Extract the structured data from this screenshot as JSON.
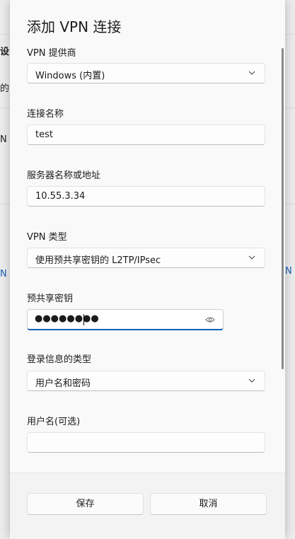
{
  "background": {
    "fragments": [
      {
        "text": "设",
        "bold": true
      },
      {
        "text": "的"
      },
      {
        "text": "N 连"
      },
      {
        "text": "N 连"
      },
      {
        "text": "N"
      }
    ]
  },
  "dialog": {
    "title": "添加 VPN 连接",
    "vpn_provider": {
      "label": "VPN 提供商",
      "value": "Windows (内置)"
    },
    "connection_name": {
      "label": "连接名称",
      "value": "test"
    },
    "server": {
      "label": "服务器名称或地址",
      "value": "10.55.3.34"
    },
    "vpn_type": {
      "label": "VPN 类型",
      "value": "使用预共享密钥的 L2TP/IPsec"
    },
    "psk": {
      "label": "预共享密钥",
      "value": "●●●●●●●●"
    },
    "signin_type": {
      "label": "登录信息的类型",
      "value": "用户名和密码"
    },
    "username": {
      "label": "用户名(可选)",
      "value": ""
    },
    "buttons": {
      "save": "保存",
      "cancel": "取消"
    }
  },
  "colors": {
    "accent": "#0f62b8"
  },
  "icons": [
    "chevron-down-icon",
    "eye-icon"
  ]
}
